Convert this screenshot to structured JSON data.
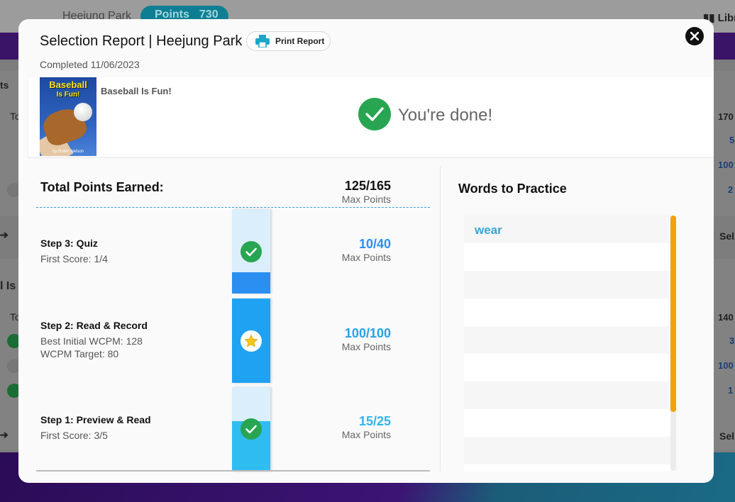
{
  "background": {
    "user_name": "Heejung Park",
    "points_label": "Points",
    "points_value": "730",
    "library_label": "Libr",
    "side_fragments": [
      "ts",
      "To",
      "l Is",
      "To",
      "Sel",
      "Sel"
    ],
    "right_numbers": [
      "170",
      "5",
      "100",
      "2",
      "140",
      "3",
      "100",
      "1"
    ]
  },
  "modal": {
    "title": "Selection Report | Heejung Park",
    "print_label": "Print Report",
    "completed": "Completed 11/06/2023",
    "book": {
      "name": "Baseball Is Fun!",
      "cover_title_line1": "Baseball",
      "cover_title_line2": "Is Fun!",
      "cover_author": "by Robin Nelson",
      "done_text": "You're done!"
    },
    "points": {
      "total_label": "Total Points Earned:",
      "total_value": "125/165",
      "total_max_label": "Max Points",
      "steps": [
        {
          "title": "Step 3: Quiz",
          "details": [
            "First Score: 1/4"
          ],
          "score": "10/40",
          "max_label": "Max Points",
          "fill_fraction": 0.25,
          "fill_color": "#2a8ff0",
          "score_color": "#2a8ff0",
          "icon": "check-circle-icon"
        },
        {
          "title": "Step 2: Read & Record",
          "details": [
            "Best Initial WCPM: 128",
            "WCPM Target: 80"
          ],
          "score": "100/100",
          "max_label": "Max Points",
          "fill_fraction": 1.0,
          "fill_color": "#20a2f2",
          "score_color": "#26a0ec",
          "icon": "star-icon"
        },
        {
          "title": "Step 1: Preview & Read",
          "details": [
            "First Score: 3/5"
          ],
          "score": "15/25",
          "max_label": "Max Points",
          "fill_fraction": 0.6,
          "fill_color": "#2fbdf0",
          "score_color": "#2eb6ea",
          "icon": "check-circle-icon"
        }
      ]
    },
    "words": {
      "title": "Words to Practice",
      "items": [
        "wear",
        "",
        "",
        "",
        "",
        "",
        "",
        "",
        "",
        ""
      ],
      "scrollbar_color": "#f5a00f"
    }
  }
}
